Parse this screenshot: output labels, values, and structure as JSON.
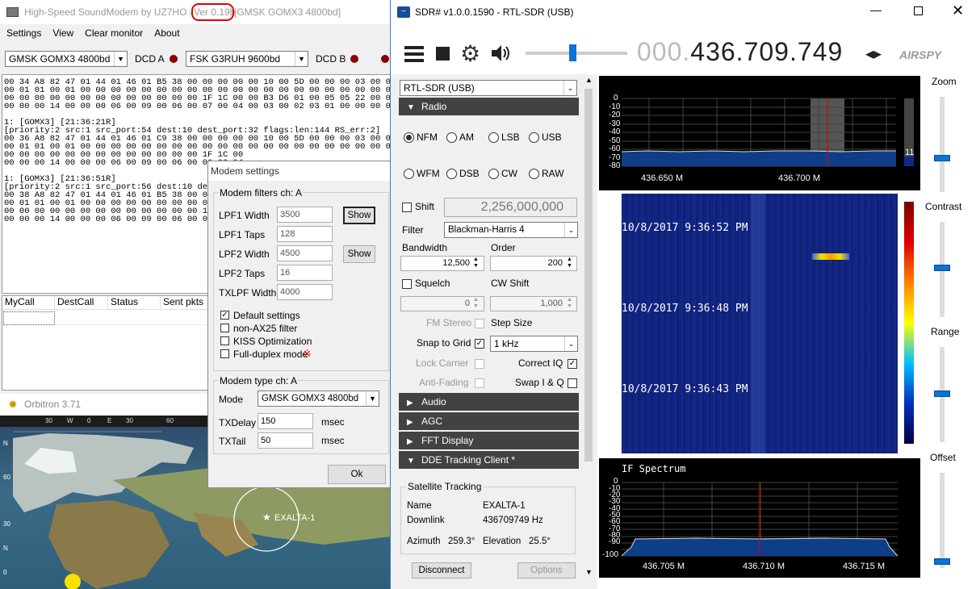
{
  "hs": {
    "title": "High-Speed SoundModem by UZ7HO - ",
    "version": "Ver 0.19b",
    "title_rest": " [GMSK GOMX3 4800bd]",
    "menu": [
      "Settings",
      "View",
      "Clear monitor",
      "About"
    ],
    "modemA": "GMSK GOMX3 4800bd",
    "dcdA": "DCD A",
    "modemB": "FSK G3RUH 9600bd",
    "dcdB": "DCD B",
    "monitor": "00 34 A8 82 47 01 44 01 46 01 B5 38 00 00 00 00 00 10 00 5D 00 00 00 03 00 01 00 3C 00 13 00\n00 01 01 00 01 00 00 00 00 00 00 00 00 00 00 00 00 00 00 00 00 00 00 00 00 00 00 00 00 00 00 00\n00 00 00 00 00 00 00 00 00 00 00 00 00 1F 1C 00 00 B3 D6 01 00 05 05 22 00 00 00 01 00 00 00\n00 00 00 14 00 00 00 06 00 09 00 06 00 07 00 04 00 03 00 02 03 01 00 00 00 00 00 5B 4F 4E 30 33 43\n\n1: [GOMX3] [21:36:21R]\n[priority:2 src:1 src_port:54 dest:10 dest_port:32 flags:len:144 RS_err:2]\n00 36 A8 82 47 01 44 01 46 01 C9 38 00 00 00 00 00 10 00 5D 00 00 00 03 00 01 00 3C 00 13 00\n00 01 01 00 01 00 00 00 00 00 00 00 00 00 00 00 00 00 00 00 00 00 00 00 00 00 00 00 00 00 00\n00 00 00 00 00 00 00 00 00 00 00 00 00 1F 1C 00\n00 00 00 14 00 00 00 06 00 09 00 06 00 06 00 04\n\n1: [GOMX3] [21:36:51R]\n[priority:2 src:1 src_port:56 dest:10 dest_port:32 flags:\n00 38 A8 82 47 01 44 01 46 01 B5 38 00 00 00 00\n00 01 01 00 01 00 00 00 00 00 00 00 00 00 00 00\n00 00 00 00 00 00 00 00 00 00 00 00 00 1F 1C 00\n00 00 00 14 00 00 00 06 00 09 00 06 00 06 00 04",
    "cols": [
      "MyCall",
      "DestCall",
      "Status",
      "Sent pkts"
    ]
  },
  "ms": {
    "title": "Modem settings",
    "group1": "Modem filters ch: A",
    "rows": [
      {
        "label": "LPF1 Width",
        "value": "3500"
      },
      {
        "label": "LPF1 Taps",
        "value": "128"
      },
      {
        "label": "LPF2 Width",
        "value": "4500"
      },
      {
        "label": "LPF2 Taps",
        "value": "16"
      },
      {
        "label": "TXLPF Width",
        "value": "4000"
      }
    ],
    "show1": "Show",
    "show2": "Show",
    "checks": [
      {
        "label": "Default settings",
        "checked": true
      },
      {
        "label": "non-AX25 filter",
        "checked": false
      },
      {
        "label": "KISS Optimization",
        "checked": false
      },
      {
        "label": "Full-duplex mode",
        "checked": false
      }
    ],
    "mark": "※",
    "group2": "Modem type ch: A",
    "mode_label": "Mode",
    "mode_value": "GMSK GOMX3 4800bd",
    "txdelay_label": "TXDelay",
    "txdelay": "150",
    "txtail_label": "TXTail",
    "txtail": "50",
    "unit": "msec",
    "ok": "Ok"
  },
  "orb": {
    "title": "Orbitron 3.71",
    "lon": [
      "30",
      "W",
      "0",
      "E",
      "30",
      "60"
    ],
    "lat": [
      "N",
      "60",
      "30",
      "N",
      "0"
    ],
    "sat": "EXALTA-1"
  },
  "sdr": {
    "title": "SDR# v1.0.0.1590 - RTL-SDR (USB)",
    "freq_dim": "000.",
    "freq": "436.709.749",
    "logo": "AIRSPY",
    "device": "RTL-SDR (USB)",
    "radio": "Radio",
    "modes": [
      {
        "label": "NFM",
        "on": true
      },
      {
        "label": "AM",
        "on": false
      },
      {
        "label": "LSB",
        "on": false
      },
      {
        "label": "USB",
        "on": false
      },
      {
        "label": "WFM",
        "on": false
      },
      {
        "label": "DSB",
        "on": false
      },
      {
        "label": "CW",
        "on": false
      },
      {
        "label": "RAW",
        "on": false
      }
    ],
    "shift": "Shift",
    "shift_val": "2,256,000,000",
    "filter": "Filter",
    "filter_val": "Blackman-Harris 4",
    "bandwidth": "Bandwidth",
    "bw_val": "12,500",
    "order": "Order",
    "order_val": "200",
    "squelch": "Squelch",
    "cwshift": "CW Shift",
    "sq_val": "0",
    "cw_val": "1,000",
    "fmstereo": "FM Stereo",
    "stepsize": "Step Size",
    "snap": "Snap to Grid",
    "step_val": "1 kHz",
    "lockcarrier": "Lock Carrier",
    "correctiq": "Correct IQ",
    "antifading": "Anti-Fading",
    "swapiq": "Swap I & Q",
    "sections": [
      "Audio",
      "AGC",
      "FFT Display",
      "DDE Tracking Client *"
    ],
    "tracking": {
      "group": "Satellite Tracking",
      "name_l": "Name",
      "name": "EXALTA-1",
      "down_l": "Downlink",
      "down": "436709749 Hz",
      "az_l": "Azimuth",
      "az": "259.3°",
      "el_l": "Elevation",
      "el": "25.5°"
    },
    "disconnect": "Disconnect",
    "options": "Options",
    "spec_ticks": [
      "0",
      "-10",
      "-20",
      "-30",
      "-40",
      "-50",
      "-60",
      "-70",
      "-80"
    ],
    "spec_x": [
      "436.650 M",
      "436.700 M"
    ],
    "meter": "11",
    "wf_times": [
      "10/8/2017 9:36:52 PM",
      "10/8/2017 9:36:48 PM",
      "10/8/2017 9:36:43 PM"
    ],
    "if_title": "IF Spectrum",
    "if_ticks": [
      "0",
      "-10",
      "-20",
      "-30",
      "-40",
      "-50",
      "-60",
      "-70",
      "-80",
      "-90",
      "-100"
    ],
    "if_x": [
      "436.705 M",
      "436.710 M",
      "436.715 M"
    ],
    "sliders": [
      {
        "label": "Zoom",
        "level": 0.85
      },
      {
        "label": "Contrast",
        "level": 0.55
      },
      {
        "label": "Range",
        "level": 0.5
      },
      {
        "label": "Offset",
        "level": 0.1
      }
    ]
  },
  "colors": {
    "accent": "#0c72d6",
    "waterfall": "#12227a",
    "panel": "#424242",
    "version_circle": "#e00000"
  }
}
